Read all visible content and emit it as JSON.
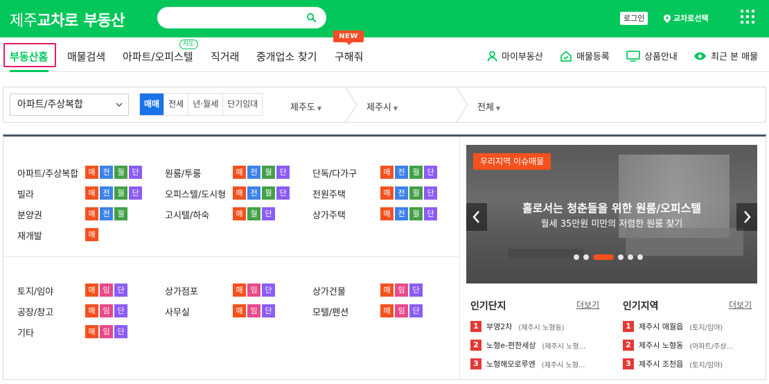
{
  "header": {
    "logo_part1": "제주",
    "logo_part2": "교차로",
    "logo_part3": "부동산",
    "search_placeholder": "",
    "login_label": "로그인",
    "region_label": "교차로선택"
  },
  "nav": {
    "items": [
      {
        "label": "부동산홈"
      },
      {
        "label": "매물검색"
      },
      {
        "label": "아파트/오피스텔"
      },
      {
        "label": "직거래"
      },
      {
        "label": "중개업소 찾기"
      },
      {
        "label": "구해줘"
      }
    ],
    "map_badge": "지도",
    "new_badge": "NEW",
    "util": [
      {
        "label": "마이부동산",
        "icon": "person-icon"
      },
      {
        "label": "매물등록",
        "icon": "home-icon"
      },
      {
        "label": "상품안내",
        "icon": "monitor-icon"
      },
      {
        "label": "최근 본 매물",
        "icon": "eye-icon"
      }
    ]
  },
  "filter": {
    "property_type": "아파트/주상복합",
    "deal_types": [
      "매매",
      "전세",
      "년·월세",
      "단기임대"
    ],
    "selected_deal": "매매",
    "region1": "제주도",
    "region2": "제주시",
    "region3": "전체"
  },
  "categories_top": [
    {
      "name": "아파트/주상복합",
      "tags": [
        "매",
        "전",
        "월",
        "단"
      ]
    },
    {
      "name": "원룸/투룸",
      "tags": [
        "매",
        "전",
        "월",
        "단"
      ]
    },
    {
      "name": "단독/다가구",
      "tags": [
        "매",
        "전",
        "월",
        "단"
      ]
    },
    {
      "name": "빌라",
      "tags": [
        "매",
        "전",
        "월",
        "단"
      ]
    },
    {
      "name": "오피스텔/도시형",
      "tags": [
        "매",
        "전",
        "월",
        "단"
      ]
    },
    {
      "name": "전원주택",
      "tags": [
        "매",
        "전",
        "월",
        "단"
      ]
    },
    {
      "name": "분양권",
      "tags": [
        "매",
        "전",
        "월"
      ]
    },
    {
      "name": "고시텔/하숙",
      "tags": [
        "매",
        "월",
        "단"
      ]
    },
    {
      "name": "상가주택",
      "tags": [
        "매",
        "전",
        "월",
        "단"
      ]
    },
    {
      "name": "재개발",
      "tags": [
        "매"
      ]
    }
  ],
  "categories_bottom": [
    {
      "name": "토지/임야",
      "tags": [
        "매",
        "임",
        "단"
      ]
    },
    {
      "name": "상가점포",
      "tags": [
        "매",
        "임",
        "단"
      ]
    },
    {
      "name": "상가건물",
      "tags": [
        "매",
        "임",
        "단"
      ]
    },
    {
      "name": "공장/창고",
      "tags": [
        "매",
        "임",
        "단"
      ]
    },
    {
      "name": "사무실",
      "tags": [
        "매",
        "임",
        "단"
      ]
    },
    {
      "name": "모텔/펜션",
      "tags": [
        "매",
        "임",
        "단"
      ]
    },
    {
      "name": "기타",
      "tags": [
        "매",
        "임",
        "단"
      ]
    }
  ],
  "banner": {
    "label": "우리지역 이슈매물",
    "title": "홀로서는 청춘들을 위한 원룸/오피스텔",
    "subtitle": "월세 35만원 미만의 저렴한 원룸 찾기",
    "active_slide": 3,
    "slide_count": 6
  },
  "popular_complex": {
    "title": "인기단지",
    "more": "더보기",
    "items": [
      {
        "rank": "1",
        "name": "부영2차",
        "loc": "(제주시 노형동)"
      },
      {
        "rank": "2",
        "name": "노형e-편한세상",
        "loc": "(제주시 노형..."
      },
      {
        "rank": "3",
        "name": "노형해모로루엔",
        "loc": "(제주시 노형..."
      }
    ]
  },
  "popular_region": {
    "title": "인기지역",
    "more": "더보기",
    "items": [
      {
        "rank": "1",
        "name": "제주시 애월읍",
        "loc": "(토지/임야)"
      },
      {
        "rank": "2",
        "name": "제주시 노형동",
        "loc": "(아파트/주상..."
      },
      {
        "rank": "3",
        "name": "제주시 조천읍",
        "loc": "(토지/임야)"
      }
    ]
  },
  "colors": {
    "brand": "#03c75a",
    "tag_매": "#f4511e",
    "tag_전": "#3d82e8",
    "tag_월": "#43a047",
    "tag_단": "#8b5cf6",
    "tag_임": "#e84a8a",
    "highlight": "#e8196b"
  }
}
